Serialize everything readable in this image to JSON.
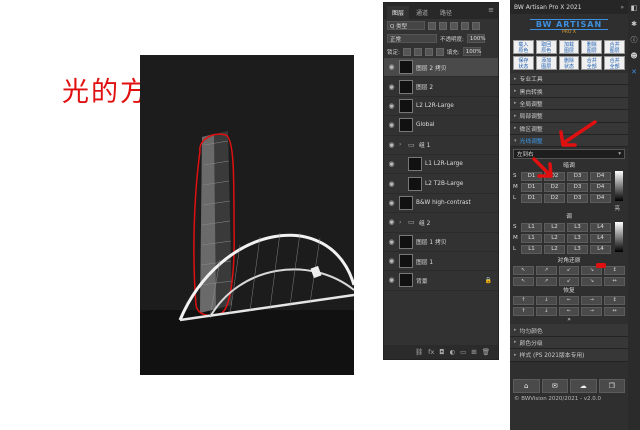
{
  "annotation": {
    "text": "光的方向"
  },
  "layers_panel": {
    "tabs": [
      "图层",
      "通道",
      "路径"
    ],
    "menu_icon": "≡",
    "filter_label": "Q 类型",
    "blend_mode": "正常",
    "opacity_label": "不透明度:",
    "opacity_value": "100%",
    "lock_label": "锁定:",
    "fill_label": "填充:",
    "fill_value": "100%",
    "layers": [
      {
        "name": "图层 2 拷贝",
        "type": "layer",
        "selected": true
      },
      {
        "name": "图层 2",
        "type": "layer"
      },
      {
        "name": "L2 L2R-Large",
        "type": "layer"
      },
      {
        "name": "Global",
        "type": "layer"
      },
      {
        "name": "组 1",
        "type": "group"
      },
      {
        "name": "L1 L2R-Large",
        "type": "layer",
        "indent": true
      },
      {
        "name": "L2 T2B-Large",
        "type": "layer",
        "indent": true
      },
      {
        "name": "B&W high-contrast",
        "type": "layer"
      },
      {
        "name": "组 2",
        "type": "group"
      },
      {
        "name": "图层 1 拷贝",
        "type": "layer"
      },
      {
        "name": "图层 1",
        "type": "layer"
      },
      {
        "name": "背景",
        "type": "layer",
        "locked": true
      }
    ],
    "footer_icons": [
      "link-icon",
      "fx-icon",
      "mask-icon",
      "adjustment-icon",
      "folder-icon",
      "new-layer-icon",
      "trash-icon"
    ]
  },
  "plugin_panel": {
    "title": "BW Artisan Pro X 2021",
    "close": "»",
    "logo": "BW ARTISAN",
    "logo_sub": "PRO X",
    "buttons": [
      "载入\n原色",
      "取回\n原色",
      "加载\n图层",
      "删除\n图层",
      "合并\n图层",
      "保存\n状态",
      "添加\n图层",
      "删除\n状态",
      "合并\n全部",
      "合并\n全部"
    ],
    "sections": [
      {
        "label": "专业工具"
      },
      {
        "label": "黑白转换"
      },
      {
        "label": "全局调整"
      },
      {
        "label": "局部调整"
      },
      {
        "label": "微区调整"
      },
      {
        "label": "光线调整",
        "highlight": true
      }
    ],
    "dropdown": "左到右",
    "dark_label": "暗调",
    "dark_rows": [
      {
        "label": "S",
        "cells": [
          "D1",
          "D2",
          "D3",
          "D4"
        ]
      },
      {
        "label": "M",
        "cells": [
          "D1",
          "D2",
          "D3",
          "D4"
        ]
      },
      {
        "label": "L",
        "cells": [
          "D1",
          "D2",
          "D3",
          "D4"
        ]
      }
    ],
    "light_label": "亮",
    "mid_label": "调",
    "light_rows": [
      {
        "label": "S",
        "cells": [
          "L1",
          "L2",
          "L3",
          "L4"
        ]
      },
      {
        "label": "M",
        "cells": [
          "L1",
          "L2",
          "L3",
          "L4"
        ]
      },
      {
        "label": "L",
        "cells": [
          "L1",
          "L2",
          "L3",
          "L4"
        ]
      }
    ],
    "contrast_label": "对角还原",
    "restore_label": "恢复",
    "contrast_cells": [
      "↖",
      "↗",
      "↙",
      "↘",
      "↕",
      "↖",
      "↗",
      "↙",
      "↘",
      "↔"
    ],
    "restore_cells": [
      "↑",
      "↓",
      "←",
      "→",
      "↕",
      "↑",
      "↓",
      "←",
      "→",
      "↔"
    ],
    "more": "»",
    "lower_sections": [
      {
        "label": "均匀颜色"
      },
      {
        "label": "颜色分级"
      },
      {
        "label": "样式 (PS 2021版本专用)"
      }
    ],
    "footer_icons": [
      "home-icon",
      "mail-icon",
      "cloud-icon",
      "copy-icon"
    ],
    "footer_glyphs": [
      "⌂",
      "✉",
      "☁",
      "❐"
    ],
    "copyright": "© BWVision 2020/2021 - v2.0.0"
  },
  "right_toolbar": {
    "icons": [
      "layers-icon",
      "adjust-icon",
      "info-icon",
      "user-icon",
      "plugin-icon"
    ],
    "glyphs": [
      "◧",
      "✱",
      "ⓘ",
      "☻",
      "✕"
    ]
  },
  "colors": {
    "annotation_red": "#e01010",
    "accent_blue": "#3d8fe0",
    "panel_bg": "#323232"
  }
}
